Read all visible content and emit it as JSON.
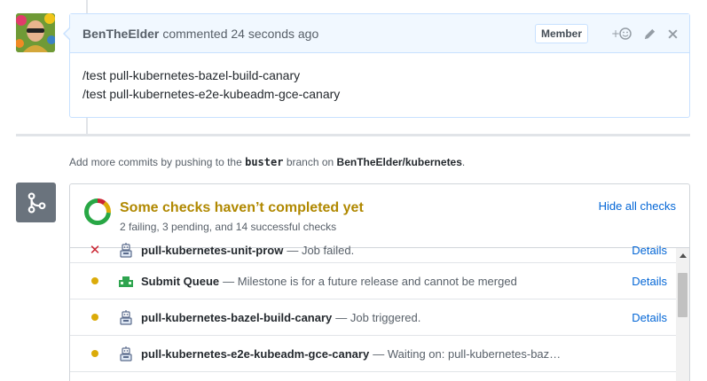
{
  "comment": {
    "author": "BenTheElder",
    "meta": "commented 24 seconds ago",
    "badge": "Member",
    "lines": [
      "/test pull-kubernetes-bazel-build-canary",
      "/test pull-kubernetes-e2e-kubeadm-gce-canary"
    ]
  },
  "push_note": {
    "prefix": "Add more commits by pushing to the",
    "branch": "buster",
    "middle": "branch on",
    "repo": "BenTheElder/kubernetes",
    "suffix": "."
  },
  "checks": {
    "title": "Some checks haven’t completed yet",
    "summary": "2 failing, 3 pending, and 14 successful checks",
    "hide_label": "Hide all checks",
    "ring": {
      "failing": 2,
      "pending": 3,
      "successful": 14
    },
    "colors": {
      "failing": "#cb2431",
      "pending": "#dbab09",
      "successful": "#28a745"
    },
    "items": [
      {
        "status": "failed",
        "name": "pull-kubernetes-unit-prow",
        "desc": "— Job failed.",
        "details": "Details",
        "icon": "prow-bot-icon"
      },
      {
        "status": "pending",
        "name": "Submit Queue",
        "desc": "— Milestone is for a future release and cannot be merged",
        "details": "Details",
        "icon": "submit-queue-icon"
      },
      {
        "status": "pending",
        "name": "pull-kubernetes-bazel-build-canary",
        "desc": "— Job triggered.",
        "details": "Details",
        "icon": "prow-bot-icon"
      },
      {
        "status": "pending",
        "name": "pull-kubernetes-e2e-kubeadm-gce-canary",
        "desc": "— Waiting on: pull-kubernetes-baz…",
        "details": "",
        "icon": "prow-bot-icon"
      }
    ]
  }
}
